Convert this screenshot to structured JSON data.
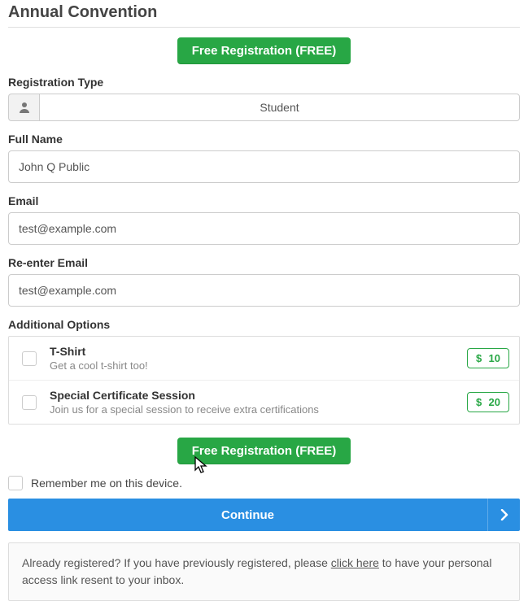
{
  "page_title": "Annual Convention",
  "free_badge": "Free Registration (FREE)",
  "labels": {
    "reg_type": "Registration Type",
    "reg_type_value": "Student",
    "full_name": "Full Name",
    "email": "Email",
    "reenter_email": "Re-enter Email",
    "additional_options": "Additional Options",
    "remember": "Remember me on this device.",
    "continue": "Continue"
  },
  "values": {
    "full_name": "John Q Public",
    "email": "test@example.com",
    "reenter_email": "test@example.com"
  },
  "options": [
    {
      "title": "T-Shirt",
      "desc": "Get a cool t-shirt too!",
      "price": "10"
    },
    {
      "title": "Special Certificate Session",
      "desc": "Join us for a special session to receive extra certifications",
      "price": "20"
    }
  ],
  "info": {
    "prefix": "Already registered? If you have previously registered, please ",
    "link": "click here",
    "suffix": " to have your personal access link resent to your inbox."
  },
  "currency_symbol": "$"
}
